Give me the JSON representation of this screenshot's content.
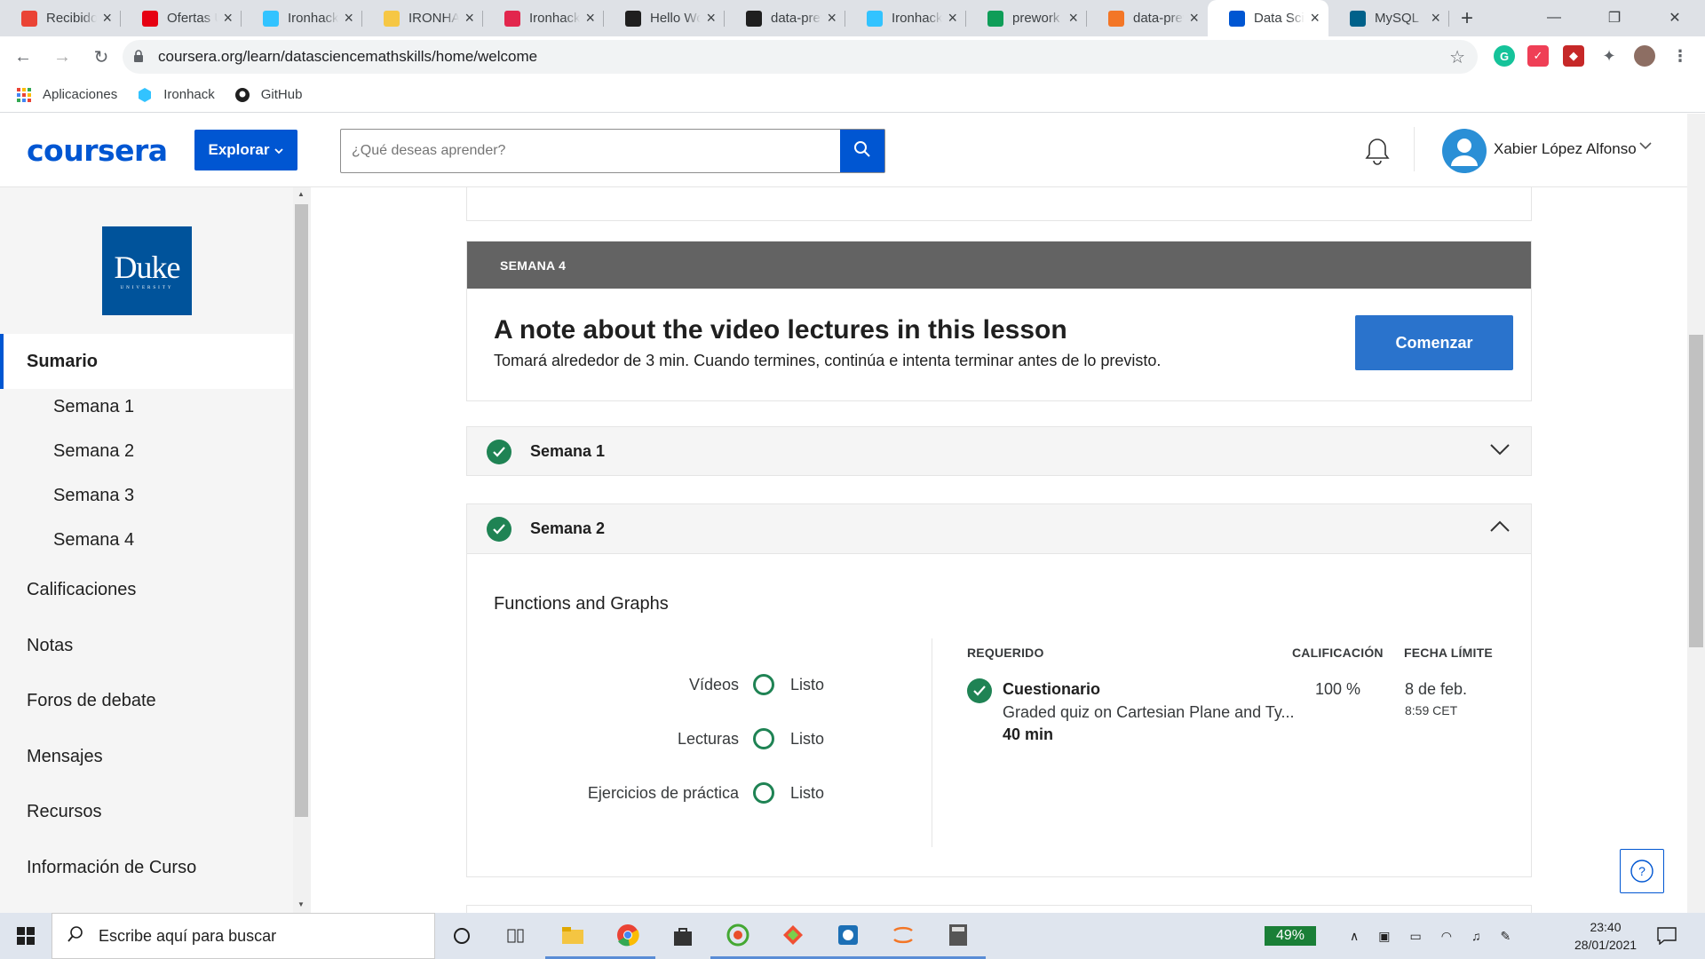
{
  "browser": {
    "tabs": [
      {
        "title": "Recibidos",
        "icon": "gmail-icon",
        "color": "#ea4335"
      },
      {
        "title": "Ofertas UNIQLO",
        "icon": "uniqlo-icon",
        "color": "#e60012"
      },
      {
        "title": "Ironhack",
        "icon": "ironhack-icon",
        "color": "#32c3ff"
      },
      {
        "title": "IRONHACK",
        "icon": "hand-icon",
        "color": "#f6c744"
      },
      {
        "title": "Ironhack",
        "icon": "m-icon",
        "color": "#e2264d"
      },
      {
        "title": "Hello World",
        "icon": "github-icon",
        "color": "#1f1f1f"
      },
      {
        "title": "data-prework",
        "icon": "github-icon",
        "color": "#1f1f1f"
      },
      {
        "title": "Ironhack",
        "icon": "ironhack-icon",
        "color": "#32c3ff"
      },
      {
        "title": "prework",
        "icon": "sheets-icon",
        "color": "#0f9d58"
      },
      {
        "title": "data-prework",
        "icon": "jupyter-icon",
        "color": "#f37626"
      },
      {
        "title": "Data Science",
        "icon": "coursera-icon",
        "color": "#0056d2"
      },
      {
        "title": "MySQL",
        "icon": "mysql-icon",
        "color": "#00618a"
      }
    ],
    "active_tab_index": 10,
    "url": "coursera.org/learn/datasciencemathskills/home/welcome",
    "bookmarks": [
      {
        "label": "Aplicaciones",
        "icon": "apps-grid-icon"
      },
      {
        "label": "Ironhack",
        "icon": "ironhack-icon"
      },
      {
        "label": "GitHub",
        "icon": "github-icon"
      }
    ]
  },
  "header": {
    "logo": "coursera",
    "explore_label": "Explorar",
    "search_placeholder": "¿Qué deseas aprender?",
    "user_name": "Xabier López Alfonso",
    "brand_color": "#0056d2"
  },
  "sidebar": {
    "university_logo": {
      "word": "Duke",
      "sub": "UNIVERSITY"
    },
    "active_item": "Sumario",
    "week_items": [
      "Semana 1",
      "Semana 2",
      "Semana 3",
      "Semana 4"
    ],
    "main_items": [
      "Calificaciones",
      "Notas",
      "Foros de debate",
      "Mensajes",
      "Recursos",
      "Información de Curso"
    ]
  },
  "main": {
    "week4": {
      "label": "SEMANA 4",
      "title": "A note about the video lectures in this lesson",
      "desc": "Tomará alrededor de 3 min. Cuando termines, continúa e intenta terminar antes de lo previsto.",
      "button": "Comenzar"
    },
    "week1": {
      "label": "Semana 1",
      "completed": true,
      "expanded": false
    },
    "week2": {
      "label": "Semana 2",
      "completed": true,
      "expanded": true,
      "topic": "Functions and Graphs",
      "progress": [
        {
          "label": "Vídeos",
          "status": "Listo"
        },
        {
          "label": "Lecturas",
          "status": "Listo"
        },
        {
          "label": "Ejercicios de práctica",
          "status": "Listo"
        }
      ],
      "columns": {
        "required": "REQUERIDO",
        "grade": "CALIFICACIÓN",
        "deadline": "FECHA LÍMITE"
      },
      "quiz": {
        "title": "Cuestionario",
        "desc": "Graded quiz on Cartesian Plane and Ty...",
        "duration": "40 min",
        "grade": "100 %",
        "deadline_date": "8 de feb.",
        "deadline_time": "8:59 CET"
      }
    },
    "help_label": "?"
  },
  "taskbar": {
    "search_placeholder": "Escribe aquí para buscar",
    "battery": "49%",
    "time": "23:40",
    "date": "28/01/2021"
  }
}
